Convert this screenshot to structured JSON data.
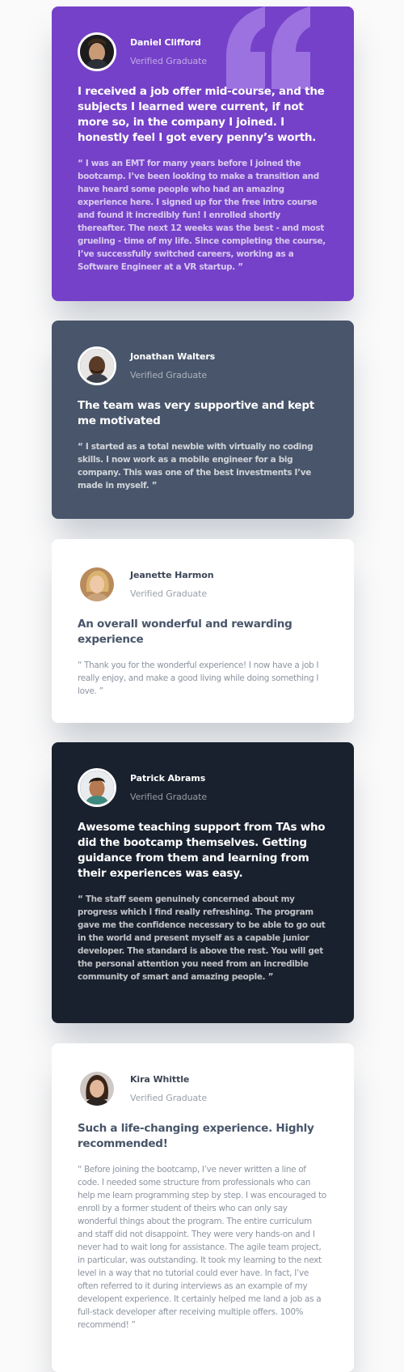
{
  "colors": {
    "moderate_violet": "#7541c8",
    "grayish_blue": "#48556a",
    "very_dark_blackish_blue": "#19212e",
    "white": "#ffffff",
    "quote_mark": "#9c71e0"
  },
  "testimonials": [
    {
      "name": "Daniel Clifford",
      "role": "Verified Graduate",
      "headline": "I received a job offer mid-course, and the subjects I learned were current, if not more so, in the company I joined. I honestly feel I got every penny’s worth.",
      "body": "“ I was an EMT for many years before I joined the bootcamp. I’ve been looking to make a transition and have heard some people who had an amazing experience here. I signed up for the free intro course and found it incredibly fun! I enrolled shortly thereafter. The next 12 weeks was the best - and most grueling - time of my life. Since completing the course, I’ve successfully switched careers, working as a Software Engineer at a VR startup. ”"
    },
    {
      "name": "Jonathan Walters",
      "role": "Verified Graduate",
      "headline": "The team was very supportive and kept me motivated",
      "body": "“ I started as a total newbie with virtually no coding skills. I now work as a mobile engineer for a big company. This was one of the best investments I’ve made in myself. ”"
    },
    {
      "name": "Jeanette Harmon",
      "role": "Verified Graduate",
      "headline": "An overall wonderful and rewarding experience",
      "body": "“ Thank you for the wonderful experience! I now have a job I really enjoy, and make a good living while doing something I love. ”"
    },
    {
      "name": "Patrick Abrams",
      "role": "Verified Graduate",
      "headline": "Awesome teaching support from TAs who did the bootcamp themselves. Getting guidance from them and learning from their experiences was easy.",
      "body": "“ The staff seem genuinely concerned about my progress which I find really refreshing. The program gave me the confidence necessary to be able to go out in the world and present myself as a capable junior developer. The standard is above the rest. You will get the personal attention you need from an incredible community of smart and amazing people. ”"
    },
    {
      "name": "Kira Whittle",
      "role": "Verified Graduate",
      "headline": "Such a life-changing experience. Highly recommended!",
      "body": "“ Before joining the bootcamp, I’ve never written a line of code. I needed some structure from professionals who can help me learn programming step by step. I was encouraged to enroll by a former student of theirs who can only say wonderful things about the program. The entire curriculum and staff did not disappoint. They were very hands-on and I never had to wait long for assistance. The agile team project, in particular, was outstanding. It took my learning to the next level in a way that no tutorial could ever have. In fact, I’ve often referred to it during interviews as an example of my developent experience. It certainly helped me land a job as a full-stack developer after receiving multiple offers. 100% recommend! ”"
    }
  ]
}
